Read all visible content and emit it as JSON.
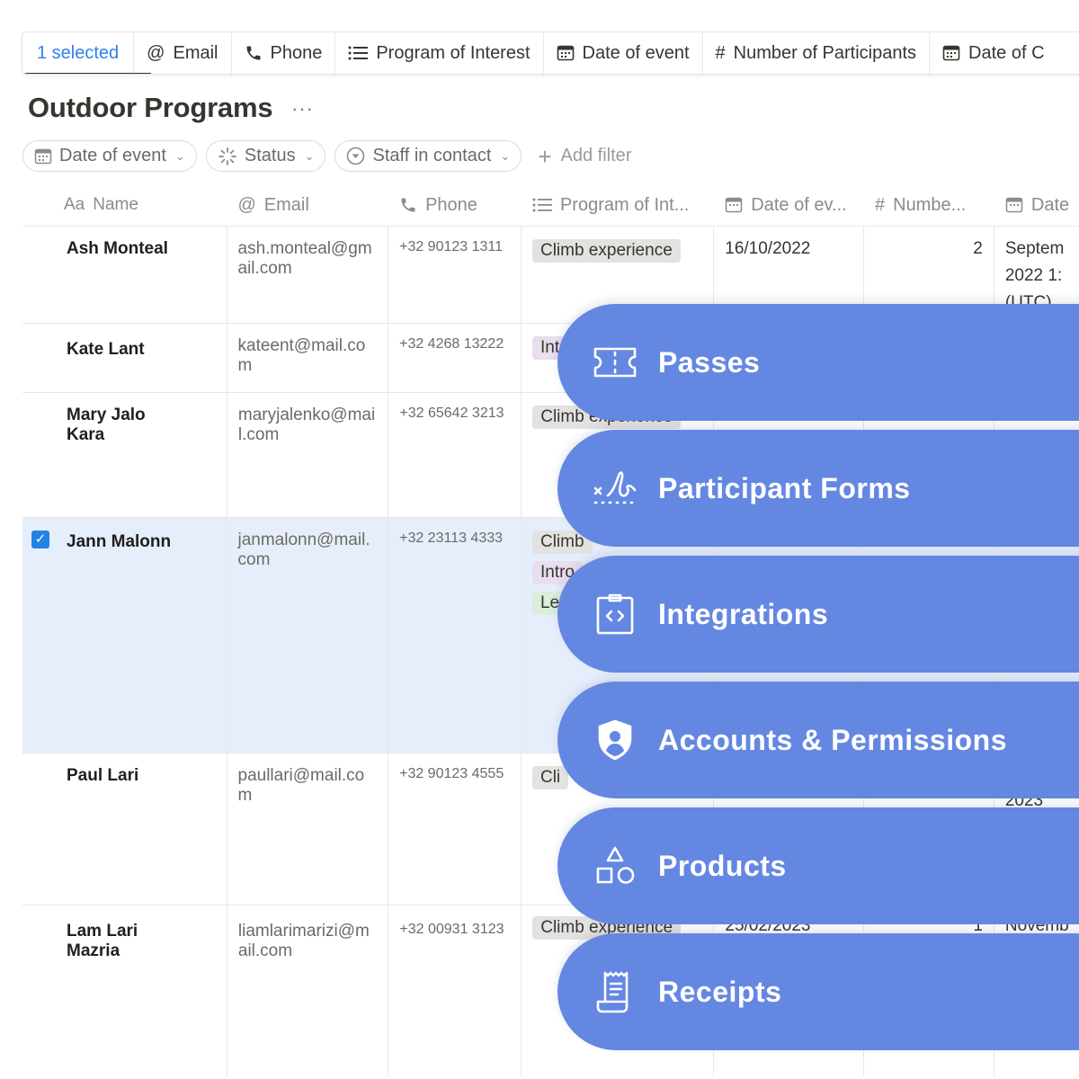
{
  "toolbar": {
    "selected_label": "1 selected",
    "items": [
      {
        "icon": "@",
        "label": "Email"
      },
      {
        "icon": "phone-icon",
        "label": "Phone"
      },
      {
        "icon": "list-icon",
        "label": "Program of Interest"
      },
      {
        "icon": "calendar-icon",
        "label": "Date of event"
      },
      {
        "icon": "#",
        "label": "Number of Participants"
      },
      {
        "icon": "calendar-icon",
        "label": "Date of C"
      }
    ]
  },
  "page": {
    "title": "Outdoor Programs",
    "more": "···"
  },
  "filters": {
    "date": "Date of event",
    "status": "Status",
    "staff": "Staff in contact",
    "add": "Add filter"
  },
  "table": {
    "headers": {
      "name_prefix": "Aa",
      "name": "Name",
      "email_prefix": "@",
      "email": "Email",
      "phone": "Phone",
      "program": "Program of Int...",
      "date": "Date of ev...",
      "number_prefix": "#",
      "number": "Numbe...",
      "date2": "Date"
    },
    "rows": [
      {
        "name": "Ash Monteal",
        "email": "ash.monteal@gmail.com",
        "phone": "+32 90123 1311",
        "tags": [
          "Climb experience"
        ],
        "date": "16/10/2022",
        "number": "2",
        "date2": "Septem 2022 1: (UTC)"
      },
      {
        "name": "Kate Lant",
        "email": "kateent@mail.com",
        "phone": "+32 4268 13222",
        "tags": [
          "Int"
        ]
      },
      {
        "name": "Mary Jalo Kara",
        "email": "maryjalenko@mail.com",
        "phone": "+32 65642 3213",
        "tags": [
          "Climb experience"
        ]
      },
      {
        "name": "Jann Malonn",
        "email": "janmalonn@mail.com",
        "phone": "+32 23113 4333",
        "tags": [
          "Climb",
          "Intro",
          "Le"
        ]
      },
      {
        "name": "Paul Lari",
        "email": "paullari@mail.com",
        "phone": "+32 90123 4555",
        "tags": [
          "Cli"
        ],
        "date2": "2023"
      },
      {
        "name": "Lam Lari Mazria",
        "email": "liamlarimarizi@mail.com",
        "phone": "+32 00931 3123",
        "tags": [
          "Climb experience"
        ],
        "date": "25/02/2023",
        "number": "1",
        "date2": "Novemb"
      }
    ]
  },
  "features": [
    {
      "label": "Passes",
      "icon": "ticket-icon"
    },
    {
      "label": "Participant Forms",
      "icon": "signature-icon"
    },
    {
      "label": "Integrations",
      "icon": "code-clipboard-icon"
    },
    {
      "label": "Accounts & Permissions",
      "icon": "shield-user-icon"
    },
    {
      "label": "Products",
      "icon": "shapes-icon"
    },
    {
      "label": "Receipts",
      "icon": "receipt-icon"
    }
  ],
  "colors": {
    "accent": "#6487e2",
    "selected_text": "#2f80ed",
    "selected_row": "#e7eefb",
    "checkbox": "#2383e2"
  }
}
